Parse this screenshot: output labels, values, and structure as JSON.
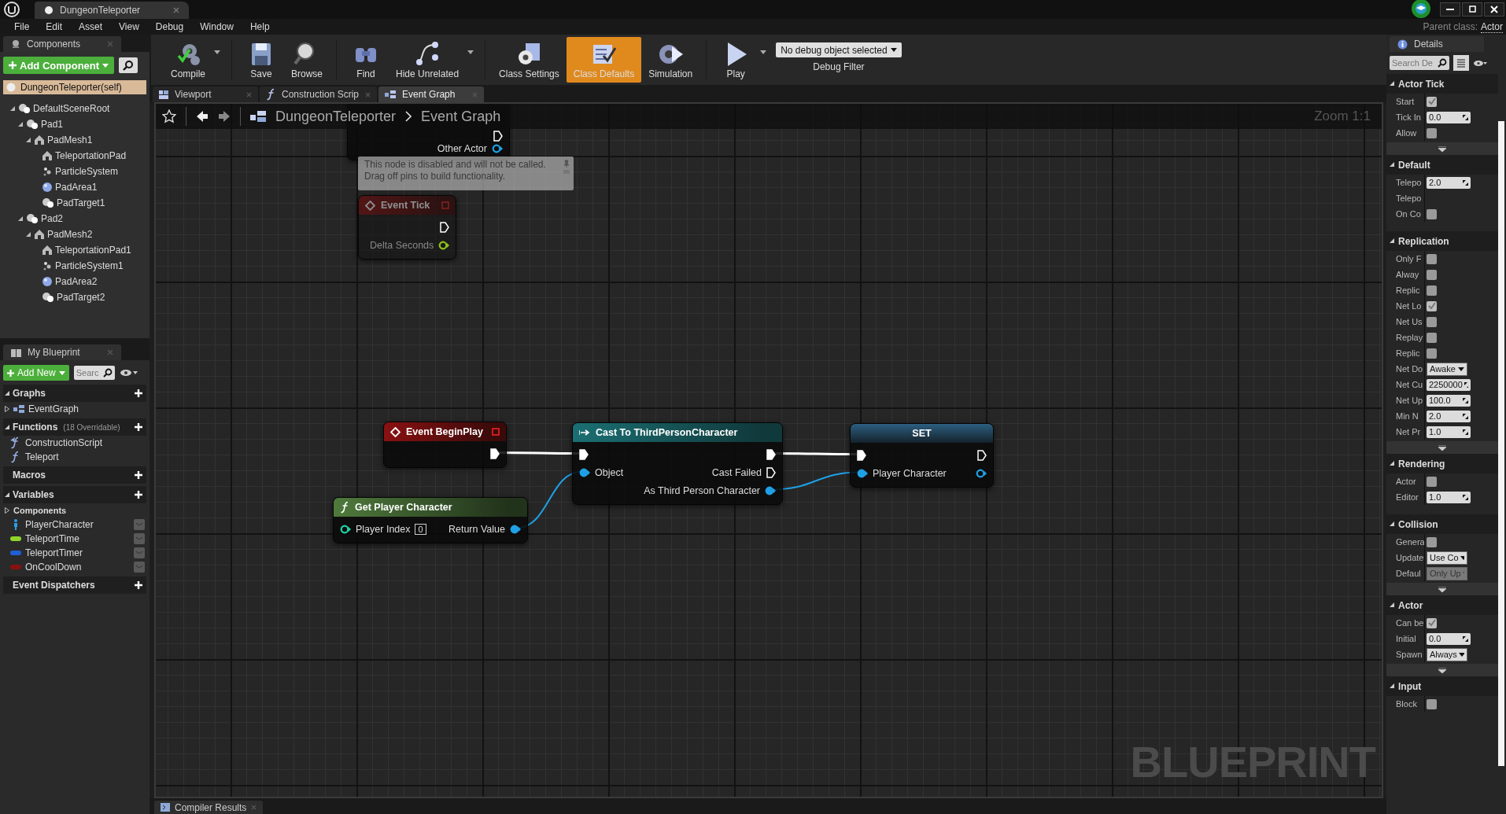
{
  "title_bar": {
    "tab": "DungeonTeleporter",
    "parent_class_label": "Parent class:",
    "parent_class": "Actor"
  },
  "menu": [
    "File",
    "Edit",
    "Asset",
    "View",
    "Debug",
    "Window",
    "Help"
  ],
  "components": {
    "tab": "Components",
    "add_button": "Add Component",
    "root": {
      "label": "DungeonTeleporter(self)",
      "selected": true
    },
    "tree": [
      {
        "label": "DefaultSceneRoot",
        "kind": "scene",
        "selected": false,
        "expanded": true,
        "children": [
          {
            "label": "Pad1",
            "kind": "scene",
            "selected": false,
            "expanded": true,
            "children": [
              {
                "label": "PadMesh1",
                "kind": "mesh",
                "selected": false,
                "expanded": true,
                "children": [
                  {
                    "label": "TeleportationPad",
                    "kind": "mesh",
                    "selected": false
                  },
                  {
                    "label": "ParticleSystem",
                    "kind": "particles",
                    "selected": false
                  },
                  {
                    "label": "PadArea1",
                    "kind": "sphere",
                    "selected": false
                  },
                  {
                    "label": "PadTarget1",
                    "kind": "scene",
                    "selected": false
                  }
                ]
              }
            ]
          },
          {
            "label": "Pad2",
            "kind": "scene",
            "selected": false,
            "expanded": true,
            "children": [
              {
                "label": "PadMesh2",
                "kind": "mesh",
                "selected": false,
                "expanded": true,
                "children": [
                  {
                    "label": "TeleportationPad1",
                    "kind": "mesh",
                    "selected": false
                  },
                  {
                    "label": "ParticleSystem1",
                    "kind": "particles",
                    "selected": false
                  },
                  {
                    "label": "PadArea2",
                    "kind": "sphere",
                    "selected": false
                  },
                  {
                    "label": "PadTarget2",
                    "kind": "scene",
                    "selected": false
                  }
                ]
              }
            ]
          }
        ]
      }
    ]
  },
  "my_blueprint": {
    "tab": "My Blueprint",
    "add_button": "Add New",
    "search_placeholder": "Searc",
    "sections": [
      {
        "title": "Graphs",
        "expanded": true,
        "items": [
          {
            "label": "EventGraph",
            "kind": "graph",
            "expanded": false
          }
        ]
      },
      {
        "title": "Functions",
        "note": "(18 Overridable)",
        "expanded": true,
        "items": [
          {
            "label": "ConstructionScript",
            "kind": "override"
          },
          {
            "label": "Teleport",
            "kind": "function"
          }
        ]
      },
      {
        "title": "Macros"
      },
      {
        "title": "Variables",
        "expanded": true,
        "items": [
          {
            "label": "Components",
            "kind": "category",
            "expanded": false
          },
          {
            "label": "PlayerCharacter",
            "kind": "object",
            "color": "#2a9ee6"
          },
          {
            "label": "TeleportTime",
            "kind": "variable",
            "color": "#8fd42a"
          },
          {
            "label": "TeleportTimer",
            "kind": "variable",
            "color": "#1f5fd6"
          },
          {
            "label": "OnCoolDown",
            "kind": "variable",
            "color": "#8a1010"
          }
        ]
      },
      {
        "title": "Event Dispatchers"
      }
    ]
  },
  "toolbar": [
    [
      {
        "label": "Compile",
        "kind": "compile",
        "dropdown": true,
        "selected": false
      }
    ],
    [
      {
        "label": "Save",
        "kind": "save",
        "dropdown": false,
        "selected": false
      },
      {
        "label": "Browse",
        "kind": "browse",
        "dropdown": false,
        "selected": false
      }
    ],
    [
      {
        "label": "Find",
        "kind": "find",
        "dropdown": false,
        "selected": false
      },
      {
        "label": "Hide Unrelated",
        "kind": "hide",
        "dropdown": true,
        "selected": false
      }
    ],
    [
      {
        "label": "Class Settings",
        "kind": "settings",
        "dropdown": false,
        "selected": false
      },
      {
        "label": "Class Defaults",
        "kind": "defaults",
        "dropdown": false,
        "selected": true
      },
      {
        "label": "Simulation",
        "kind": "simulation",
        "dropdown": false,
        "selected": false
      }
    ],
    [
      {
        "label": "Play",
        "kind": "play",
        "dropdown": true,
        "selected": false
      }
    ]
  ],
  "debug_filter": {
    "value": "No debug object selected",
    "label": "Debug Filter"
  },
  "editor_tabs": [
    {
      "label": "Viewport",
      "kind": "viewport",
      "selected": false
    },
    {
      "label": "Construction Scrip",
      "kind": "function",
      "selected": false
    },
    {
      "label": "Event Graph",
      "kind": "graph",
      "selected": true
    }
  ],
  "graph": {
    "breadcrumb": [
      "DungeonTeleporter",
      "Event Graph"
    ],
    "zoom": "Zoom 1:1",
    "watermark": "BLUEPRINT",
    "comment": "This node is disabled and will not be called.\nDrag off pins to build functionality.",
    "nodes": [
      {
        "kind": "event",
        "disabled": false,
        "outputs": [
          {
            "kind": "exec",
            "connected": false
          },
          {
            "kind": "data",
            "label": "Other Actor",
            "color": "#1fa0e6",
            "connected": false
          }
        ]
      },
      {
        "kind": "event",
        "title": "Event Tick",
        "disabled": true,
        "outputs": [
          {
            "kind": "exec",
            "connected": false
          },
          {
            "kind": "data",
            "label": "Delta Seconds",
            "color": "#8fc11b",
            "connected": false
          }
        ]
      },
      {
        "kind": "event",
        "title": "Event BeginPlay",
        "disabled": false,
        "outputs": [
          {
            "kind": "exec",
            "connected": true
          }
        ]
      },
      {
        "kind": "function",
        "title": "Get Player Character",
        "disabled": false,
        "inputs": [
          {
            "kind": "data",
            "label": "Player Index",
            "color": "#1fd3a4",
            "connected": false,
            "value": "0"
          }
        ],
        "outputs": [
          {
            "kind": "data",
            "label": "Return Value",
            "color": "#1fa0e6",
            "connected": true
          }
        ]
      },
      {
        "kind": "cast",
        "title": "Cast To ThirdPersonCharacter",
        "disabled": false,
        "inputs": [
          {
            "kind": "exec",
            "connected": true
          },
          {
            "kind": "data",
            "label": "Object",
            "color": "#1fa0e6",
            "connected": true
          }
        ],
        "outputs": [
          {
            "kind": "exec",
            "connected": true
          },
          {
            "kind": "exec",
            "label": "Cast Failed",
            "connected": false
          },
          {
            "kind": "data",
            "label": "As Third Person Character",
            "color": "#1fa0e6",
            "connected": true
          }
        ]
      },
      {
        "kind": "set",
        "title": "SET",
        "disabled": false,
        "inputs": [
          {
            "kind": "exec",
            "connected": true
          },
          {
            "kind": "data",
            "label": "Player Character",
            "color": "#1fa0e6",
            "connected": true
          }
        ],
        "outputs": [
          {
            "kind": "exec",
            "connected": false
          },
          {
            "kind": "data",
            "color": "#1fa0e6",
            "connected": false
          }
        ]
      }
    ]
  },
  "details": {
    "tab": "Details",
    "search_placeholder": "Search De",
    "sections": [
      {
        "title": "Actor Tick",
        "advanced": true,
        "rows": [
          {
            "label": "Start",
            "kind": "checkbox",
            "checked": true
          },
          {
            "label": "Tick In",
            "kind": "number",
            "value": "0.0"
          },
          {
            "label": "Allow",
            "kind": "checkbox",
            "checked": false
          }
        ]
      },
      {
        "title": "Default",
        "advanced": false,
        "rows": [
          {
            "label": "Telepo",
            "kind": "number",
            "value": "2.0"
          },
          {
            "label": "Telepo",
            "kind": "label"
          },
          {
            "label": "On Co",
            "kind": "checkbox",
            "checked": false
          }
        ]
      },
      {
        "title": "Replication",
        "advanced": true,
        "rows": [
          {
            "label": "Only F",
            "kind": "checkbox",
            "checked": false
          },
          {
            "label": "Alway",
            "kind": "checkbox",
            "checked": false
          },
          {
            "label": "Replic",
            "kind": "checkbox",
            "checked": false
          },
          {
            "label": "Net Lo",
            "kind": "checkbox",
            "checked": true
          },
          {
            "label": "Net Us",
            "kind": "checkbox",
            "checked": false
          },
          {
            "label": "Replay",
            "kind": "checkbox",
            "checked": false
          },
          {
            "label": "Replic",
            "kind": "checkbox",
            "checked": false
          },
          {
            "label": "Net Do",
            "kind": "dropdown",
            "value": "Awake",
            "disabled": false
          },
          {
            "label": "Net Cu",
            "kind": "number",
            "value": "2250000"
          },
          {
            "label": "Net Up",
            "kind": "number",
            "value": "100.0"
          },
          {
            "label": "Min N",
            "kind": "number",
            "value": "2.0"
          },
          {
            "label": "Net Pr",
            "kind": "number",
            "value": "1.0"
          }
        ]
      },
      {
        "title": "Rendering",
        "advanced": false,
        "rows": [
          {
            "label": "Actor",
            "kind": "checkbox",
            "checked": false
          },
          {
            "label": "Editor",
            "kind": "number",
            "value": "1.0"
          }
        ]
      },
      {
        "title": "Collision",
        "advanced": true,
        "rows": [
          {
            "label": "Genera",
            "kind": "checkbox",
            "checked": false
          },
          {
            "label": "Update",
            "kind": "dropdown",
            "value": "Use Co",
            "disabled": false
          },
          {
            "label": "Defaul",
            "kind": "dropdown",
            "value": "Only Up",
            "disabled": true
          }
        ]
      },
      {
        "title": "Actor",
        "advanced": true,
        "rows": [
          {
            "label": "Can be",
            "kind": "checkbox",
            "checked": true
          },
          {
            "label": "Initial",
            "kind": "number",
            "value": "0.0"
          },
          {
            "label": "Spawn",
            "kind": "dropdown",
            "value": "Always",
            "disabled": false
          }
        ]
      },
      {
        "title": "Input",
        "advanced": false,
        "rows": [
          {
            "label": "Block",
            "kind": "checkbox",
            "checked": false
          }
        ]
      }
    ]
  },
  "bottom_tabs": [
    "Compiler Results"
  ]
}
